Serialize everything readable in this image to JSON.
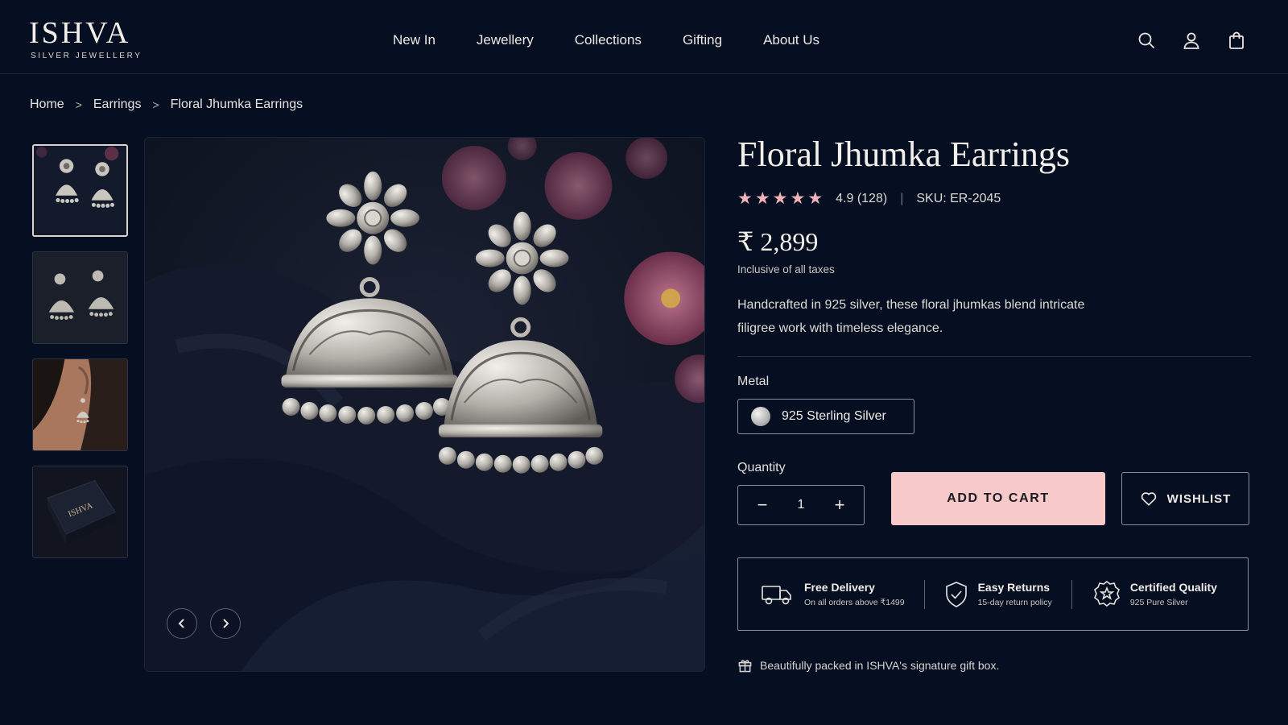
{
  "brand": {
    "name": "ISHVA",
    "tagline": "SILVER JEWELLERY"
  },
  "nav": {
    "items": [
      {
        "label": "New In"
      },
      {
        "label": "Jewellery"
      },
      {
        "label": "Collections"
      },
      {
        "label": "Gifting"
      },
      {
        "label": "About Us"
      }
    ]
  },
  "header_icons": [
    "search-icon",
    "user-icon",
    "shopping-bag-icon"
  ],
  "breadcrumb": {
    "items": [
      "Home",
      "Earrings",
      "Floral Jhumka Earrings"
    ],
    "separator": ">"
  },
  "gallery": {
    "thumbnails": [
      {
        "name": "thumb-front-view",
        "active": true
      },
      {
        "name": "thumb-side-view",
        "active": false
      },
      {
        "name": "thumb-worn-view",
        "active": false
      },
      {
        "name": "thumb-gift-box",
        "active": false,
        "box_text": "ISHVA"
      }
    ],
    "prev_icon": "chevron-left-icon",
    "next_icon": "chevron-right-icon"
  },
  "product": {
    "title": "Floral Jhumka Earrings",
    "rating_stars": 5,
    "rating_text": "4.9 (128)",
    "rating_separator": "|",
    "sku": "SKU: ER-2045",
    "price": "₹ 2,899",
    "tax_note": "Inclusive of all taxes",
    "description": "Handcrafted in 925 silver, these floral jhumkas blend intricate filigree work with timeless elegance.",
    "metal_label": "Metal",
    "metal_option": "925 Sterling Silver",
    "quantity_label": "Quantity",
    "quantity_value": "1",
    "qty_minus": "−",
    "qty_plus": "+",
    "add_to_cart": "ADD TO CART",
    "wishlist": "WISHLIST"
  },
  "features": [
    {
      "title": "Free Delivery",
      "subtitle": "On all orders above ₹1499",
      "icon": "truck-icon"
    },
    {
      "title": "Easy Returns",
      "subtitle": "15-day return policy",
      "icon": "shield-check-icon"
    },
    {
      "title": "Certified Quality",
      "subtitle": "925 Pure Silver",
      "icon": "certified-badge-icon"
    }
  ],
  "gift_note": "Beautifully packed in ISHVA's signature gift box.",
  "colors": {
    "background": "#060f22",
    "accent_pink": "#f7c9c8",
    "star_color": "#f0b3b9",
    "text_light": "#f3f0ea"
  }
}
